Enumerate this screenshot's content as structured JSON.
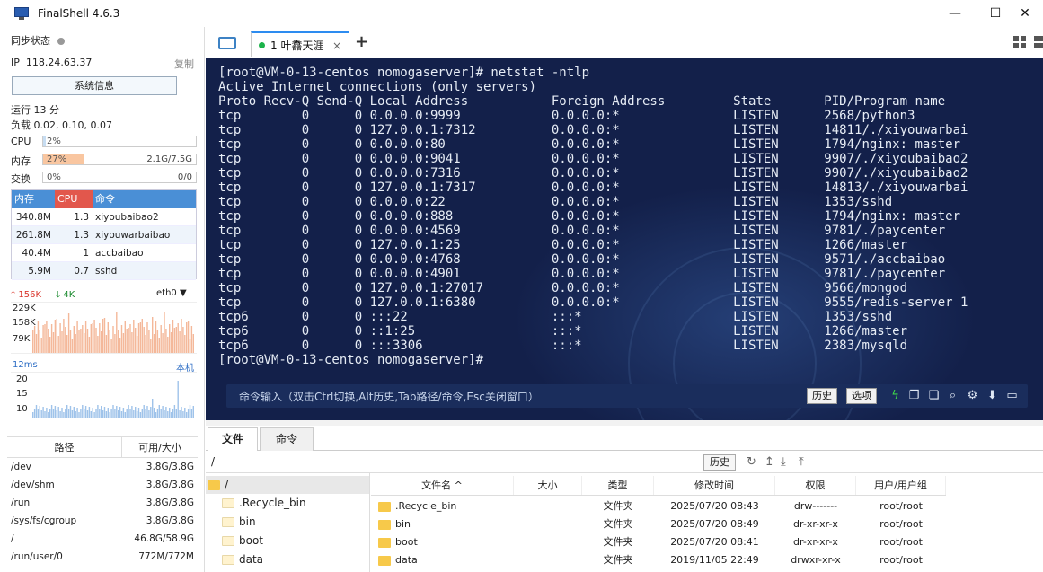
{
  "window": {
    "title": "FinalShell 4.6.3"
  },
  "status": {
    "sync_label": "同步状态",
    "ip_label": "IP",
    "ip": "118.24.63.37",
    "copy_label": "复制",
    "sysinfo_button": "系统信息",
    "uptime": "运行 13 分",
    "load": "负载 0.02, 0.10, 0.07"
  },
  "meters": [
    {
      "label": "CPU",
      "pct": "2%",
      "value": "",
      "fraction": 0.02,
      "color": "#c7ddf2"
    },
    {
      "label": "内存",
      "pct": "27%",
      "value": "2.1G/7.5G",
      "fraction": 0.27,
      "color": "#f9c6a0"
    },
    {
      "label": "交换",
      "pct": "0%",
      "value": "0/0",
      "fraction": 0.0,
      "color": "#c7ddf2"
    }
  ],
  "processes": {
    "headers": [
      "内存",
      "CPU",
      "命令"
    ],
    "header_colors": [
      "#4a8fd6",
      "#e2574c",
      "#4a8fd6"
    ],
    "rows": [
      {
        "mem": "340.8M",
        "cpu": "1.3",
        "cmd": "xiyoubaibao2"
      },
      {
        "mem": "261.8M",
        "cpu": "1.3",
        "cmd": "xiyouwarbaibao"
      },
      {
        "mem": "40.4M",
        "cpu": "1",
        "cmd": "accbaibao"
      },
      {
        "mem": "5.9M",
        "cpu": "0.7",
        "cmd": "sshd"
      }
    ]
  },
  "network": {
    "up": "156K",
    "down": "4K",
    "iface": "eth0",
    "ticks": [
      "229K",
      "158K",
      "79K"
    ],
    "latency": "12ms",
    "host_label": "本机",
    "latency_ticks": [
      "20",
      "15",
      "10"
    ]
  },
  "disks": {
    "headers": [
      "路径",
      "可用/大小"
    ],
    "rows": [
      {
        "path": "/dev",
        "value": "3.8G/3.8G"
      },
      {
        "path": "/dev/shm",
        "value": "3.8G/3.8G"
      },
      {
        "path": "/run",
        "value": "3.8G/3.8G"
      },
      {
        "path": "/sys/fs/cgroup",
        "value": "3.8G/3.8G"
      },
      {
        "path": "/",
        "value": "46.8G/58.9G"
      },
      {
        "path": "/run/user/0",
        "value": "772M/772M"
      }
    ]
  },
  "tabs": {
    "session_label": "1 叶馫天涯",
    "close": "×",
    "add": "+"
  },
  "terminal": {
    "lines": [
      "[root@VM-0-13-centos nomogaserver]# netstat -ntlp",
      "Active Internet connections (only servers)",
      "Proto Recv-Q Send-Q Local Address           Foreign Address         State       PID/Program name",
      "tcp        0      0 0.0.0.0:9999            0.0.0.0:*               LISTEN      2568/python3",
      "tcp        0      0 127.0.0.1:7312          0.0.0.0:*               LISTEN      14811/./xiyouwarbai",
      "tcp        0      0 0.0.0.0:80              0.0.0.0:*               LISTEN      1794/nginx: master",
      "tcp        0      0 0.0.0.0:9041            0.0.0.0:*               LISTEN      9907/./xiyoubaibao2",
      "tcp        0      0 0.0.0.0:7316            0.0.0.0:*               LISTEN      9907/./xiyoubaibao2",
      "tcp        0      0 127.0.0.1:7317          0.0.0.0:*               LISTEN      14813/./xiyouwarbai",
      "tcp        0      0 0.0.0.0:22              0.0.0.0:*               LISTEN      1353/sshd",
      "tcp        0      0 0.0.0.0:888             0.0.0.0:*               LISTEN      1794/nginx: master",
      "tcp        0      0 0.0.0.0:4569            0.0.0.0:*               LISTEN      9781/./paycenter",
      "tcp        0      0 127.0.0.1:25            0.0.0.0:*               LISTEN      1266/master",
      "tcp        0      0 0.0.0.0:4768            0.0.0.0:*               LISTEN      9571/./accbaibao",
      "tcp        0      0 0.0.0.0:4901            0.0.0.0:*               LISTEN      9781/./paycenter",
      "tcp        0      0 127.0.0.1:27017         0.0.0.0:*               LISTEN      9566/mongod",
      "tcp        0      0 127.0.0.1:6380          0.0.0.0:*               LISTEN      9555/redis-server 1",
      "tcp6       0      0 :::22                   :::*                    LISTEN      1353/sshd",
      "tcp6       0      0 ::1:25                  :::*                    LISTEN      1266/master",
      "tcp6       0      0 :::3306                 :::*                    LISTEN      2383/mysqld",
      "[root@VM-0-13-centos nomogaserver]#"
    ],
    "cmd_placeholder": "命令输入（双击Ctrl切换,Alt历史,Tab路径/命令,Esc关闭窗口）",
    "history_button": "历史",
    "options_button": "选项"
  },
  "files": {
    "tabs": [
      "文件",
      "命令"
    ],
    "path": "/",
    "history_button": "历史",
    "tree": [
      ".Recycle_bin",
      "bin",
      "boot",
      "data"
    ],
    "tree_root": "/",
    "headers": [
      "文件名",
      "大小",
      "类型",
      "修改时间",
      "权限",
      "用户/用户组"
    ],
    "sort_indicator": "^",
    "rows": [
      {
        "name": ".Recycle_bin",
        "size": "",
        "type": "文件夹",
        "mtime": "2025/07/20 08:43",
        "perm": "drw-------",
        "owner": "root/root"
      },
      {
        "name": "bin",
        "size": "",
        "type": "文件夹",
        "mtime": "2025/07/20 08:49",
        "perm": "dr-xr-xr-x",
        "owner": "root/root"
      },
      {
        "name": "boot",
        "size": "",
        "type": "文件夹",
        "mtime": "2025/07/20 08:41",
        "perm": "dr-xr-xr-x",
        "owner": "root/root"
      },
      {
        "name": "data",
        "size": "",
        "type": "文件夹",
        "mtime": "2019/11/05 22:49",
        "perm": "drwxr-xr-x",
        "owner": "root/root"
      }
    ]
  }
}
